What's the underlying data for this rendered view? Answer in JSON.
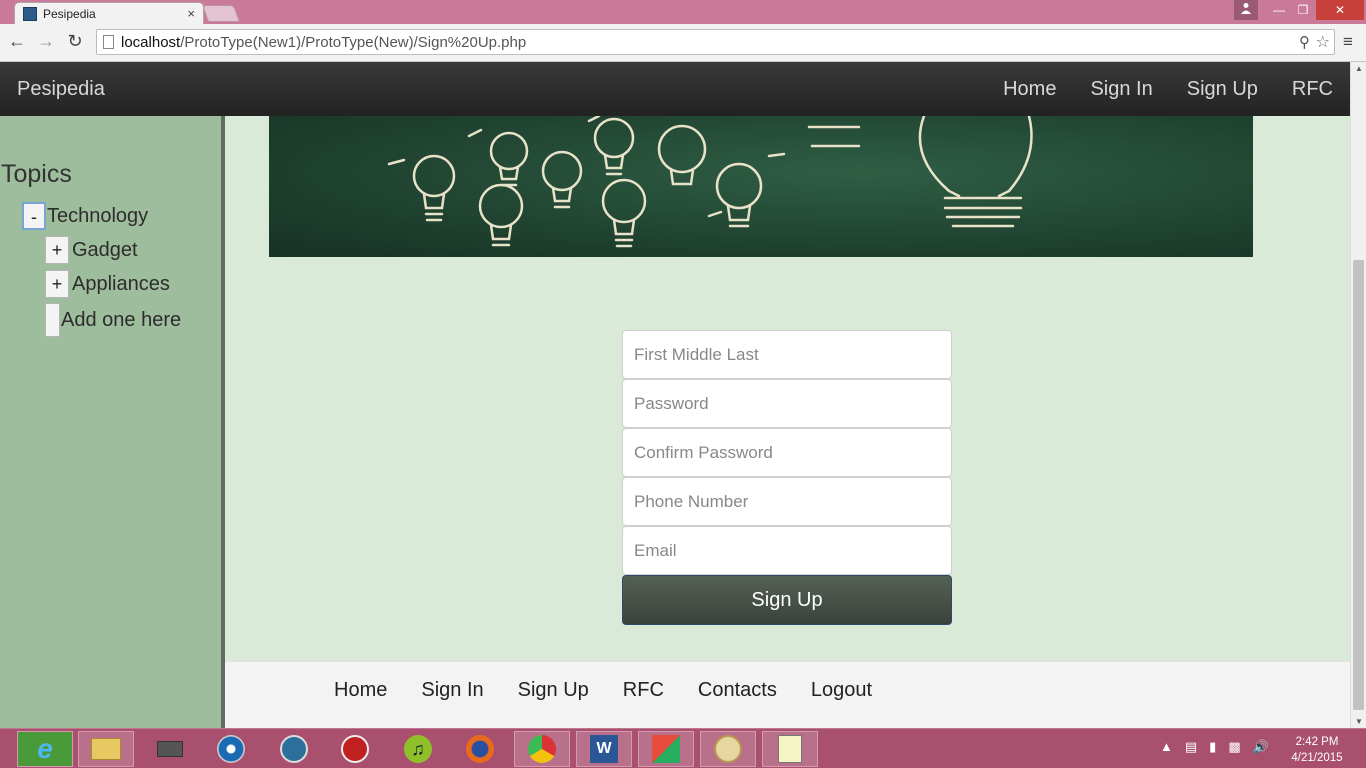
{
  "browser": {
    "tab_title": "Pesipedia",
    "tab_close": "×",
    "url_host": "localhost",
    "url_path": "/ProtoType(New1)/ProtoType(New)/Sign%20Up.php",
    "nav_back": "←",
    "nav_forward": "→",
    "nav_reload": "↻",
    "menu": "≡"
  },
  "navbar": {
    "brand": "Pesipedia",
    "links": [
      "Home",
      "Sign In",
      "Sign Up",
      "RFC"
    ]
  },
  "sidebar": {
    "title": "Topics",
    "items": [
      {
        "toggle": "-",
        "label": "Technology"
      },
      {
        "toggle": "+",
        "label": "Gadget"
      },
      {
        "toggle": "+",
        "label": "Appliances"
      },
      {
        "toggle": "",
        "label": "Add one here"
      }
    ]
  },
  "form": {
    "name_placeholder": "First Middle Last",
    "password_placeholder": "Password",
    "confirm_placeholder": "Confirm Password",
    "phone_placeholder": "Phone Number",
    "email_placeholder": "Email",
    "submit_label": "Sign Up"
  },
  "footer": {
    "links": [
      "Home",
      "Sign In",
      "Sign Up",
      "RFC",
      "Contacts",
      "Logout"
    ]
  },
  "taskbar": {
    "apps": [
      "internet-explorer",
      "file-explorer",
      "scanner",
      "dvd-player",
      "media-player",
      "recorder",
      "itunes",
      "firefox",
      "chrome",
      "word",
      "photos",
      "paint",
      "notepad"
    ],
    "time": "2:42 PM",
    "date": "4/21/2015"
  },
  "colors": {
    "page_bg": "#d9ead8",
    "sidebar_bg": "#9ebd9c",
    "navbar_bg": "#2a2a2a",
    "submit_bg": "#4a544b",
    "taskbar_bg": "#a9506f"
  }
}
